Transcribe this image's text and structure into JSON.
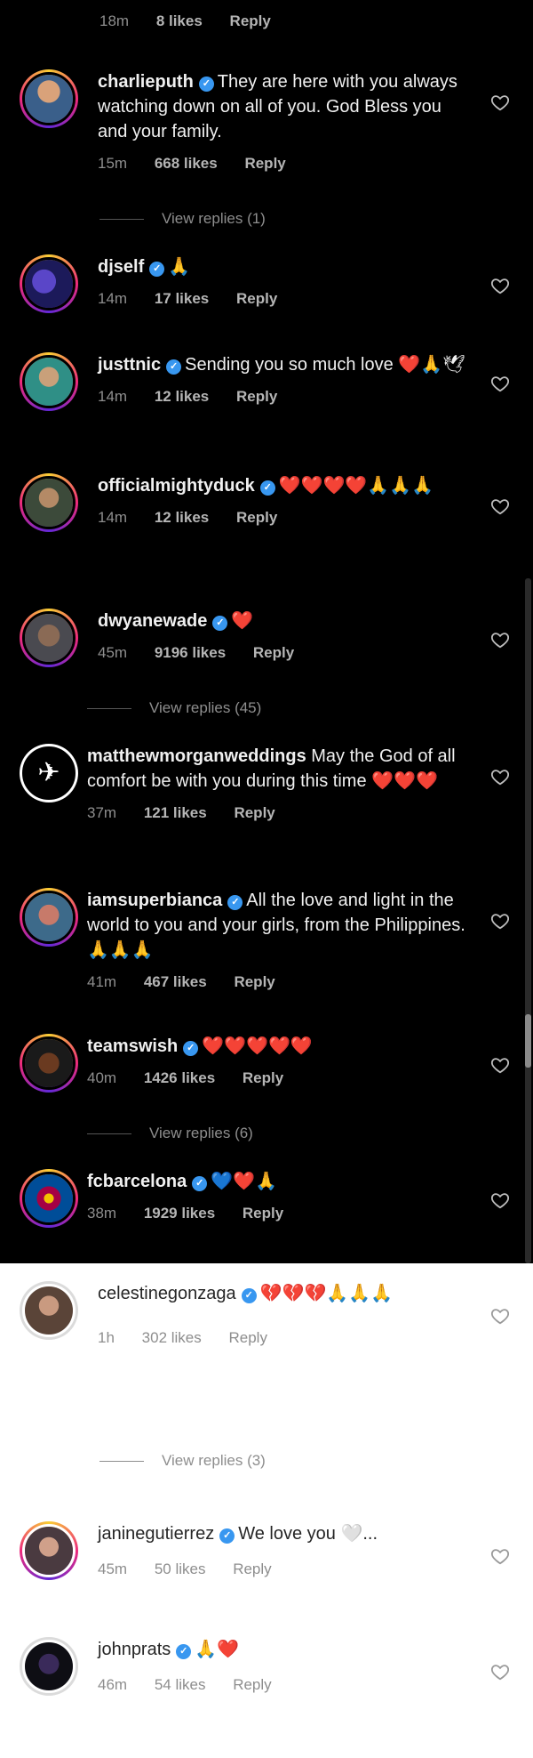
{
  "top_meta": {
    "time": "18m",
    "likes": "8 likes",
    "reply": "Reply"
  },
  "comments_panel1": [
    {
      "user": "charlieputh",
      "verified": true,
      "text": "They are here with you always watching down on all of you. God Bless you and your family.",
      "time": "15m",
      "likes": "668 likes",
      "reply": "Reply",
      "view_replies": "View replies (1)"
    },
    {
      "user": "djself",
      "verified": true,
      "text": "🙏",
      "time": "14m",
      "likes": "17 likes",
      "reply": "Reply"
    },
    {
      "user": "justtnic",
      "verified": true,
      "text": "Sending you so much love ❤️🙏🕊",
      "time": "14m",
      "likes": "12 likes",
      "reply": "Reply"
    },
    {
      "user": "officialmightyduck",
      "verified": true,
      "text": "❤️❤️❤️❤️🙏🙏🙏",
      "time": "14m",
      "likes": "12 likes",
      "reply": "Reply"
    }
  ],
  "comments_panel2": [
    {
      "user": "dwyanewade",
      "verified": true,
      "text": "❤️",
      "time": "45m",
      "likes": "9196 likes",
      "reply": "Reply",
      "view_replies": "View replies (45)"
    },
    {
      "user": "matthewmorganweddings",
      "verified": false,
      "text": "May the God of all comfort be with you during this time ❤️❤️❤️",
      "time": "37m",
      "likes": "121 likes",
      "reply": "Reply"
    },
    {
      "user": "iamsuperbianca",
      "verified": true,
      "text": "All the love and light in the world to you and your girls, from the Philippines. 🙏🙏🙏",
      "time": "41m",
      "likes": "467 likes",
      "reply": "Reply"
    },
    {
      "user": "teamswish",
      "verified": true,
      "text": "❤️❤️❤️❤️❤️",
      "time": "40m",
      "likes": "1426 likes",
      "reply": "Reply",
      "view_replies": "View replies (6)"
    },
    {
      "user": "fcbarcelona",
      "verified": true,
      "text": "💙❤️🙏",
      "time": "38m",
      "likes": "1929 likes",
      "reply": "Reply"
    }
  ],
  "comments_panel3": [
    {
      "user": "celestinegonzaga",
      "verified": true,
      "text": "💔💔💔🙏🙏🙏",
      "time": "1h",
      "likes": "302 likes",
      "reply": "Reply",
      "view_replies": "View replies (3)"
    },
    {
      "user": "janinegutierrez",
      "verified": true,
      "text": "We love you 🤍...",
      "time": "45m",
      "likes": "50 likes",
      "reply": "Reply"
    },
    {
      "user": "johnprats",
      "verified": true,
      "text": "🙏❤️",
      "time": "46m",
      "likes": "54 likes",
      "reply": "Reply"
    }
  ],
  "icons": {
    "like": "heart-outline-icon",
    "verified": "verified-badge-icon"
  },
  "colors": {
    "verified": "#3897f0",
    "dark_bg": "#000000",
    "light_bg": "#ffffff",
    "meta": "#8e8e8e"
  }
}
